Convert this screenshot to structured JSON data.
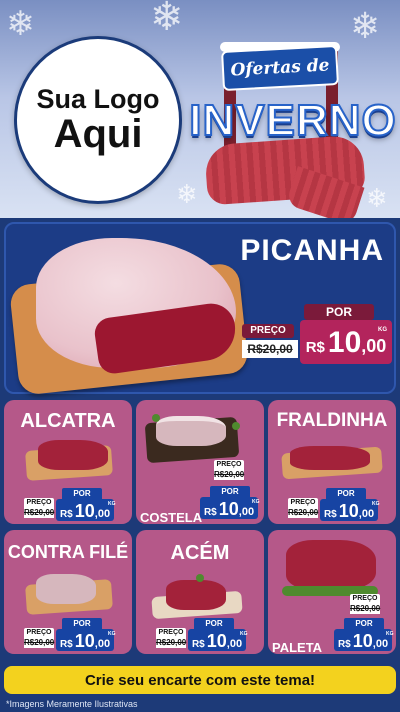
{
  "header": {
    "logo_line1": "Sua Logo",
    "logo_line2": "Aqui",
    "banner_small": "Ofertas de",
    "banner_big": "INVERNO"
  },
  "featured": {
    "name": "PICANHA",
    "preco_label": "PREÇO",
    "old_price": "R$20,00",
    "por_label": "POR",
    "currency": "R$",
    "price_int": "10",
    "price_dec": ",00",
    "unit": "KG"
  },
  "products": [
    {
      "name": "ALCATRA",
      "preco_label": "PREÇO",
      "old_price": "R$20,00",
      "por_label": "POR",
      "currency": "R$",
      "price_int": "10",
      "price_dec": ",00",
      "unit": "KG"
    },
    {
      "name": "COSTELA",
      "preco_label": "PREÇO",
      "old_price": "R$20,00",
      "por_label": "POR",
      "currency": "R$",
      "price_int": "10",
      "price_dec": ",00",
      "unit": "KG"
    },
    {
      "name": "FRALDINHA",
      "preco_label": "PREÇO",
      "old_price": "R$20,00",
      "por_label": "POR",
      "currency": "R$",
      "price_int": "10",
      "price_dec": ",00",
      "unit": "KG"
    },
    {
      "name": "CONTRA FILÉ",
      "preco_label": "PREÇO",
      "old_price": "R$20,00",
      "por_label": "POR",
      "currency": "R$",
      "price_int": "10",
      "price_dec": ",00",
      "unit": "KG"
    },
    {
      "name": "ACÉM",
      "preco_label": "PREÇO",
      "old_price": "R$20,00",
      "por_label": "POR",
      "currency": "R$",
      "price_int": "10",
      "price_dec": ",00",
      "unit": "KG"
    },
    {
      "name": "PALETA",
      "preco_label": "PREÇO",
      "old_price": "R$20,00",
      "por_label": "POR",
      "currency": "R$",
      "price_int": "10",
      "price_dec": ",00",
      "unit": "KG"
    }
  ],
  "footer": {
    "cta": "Crie seu encarte com este tema!",
    "disclaimer": "*Imagens Meramente Ilustrativas"
  },
  "colors": {
    "background": "#1d3a78",
    "featured_panel": "#1c3c86",
    "product_card": "#b55889",
    "price_red": "#b3245c",
    "price_blue": "#1744a3",
    "footer_bar": "#f3d21e"
  }
}
